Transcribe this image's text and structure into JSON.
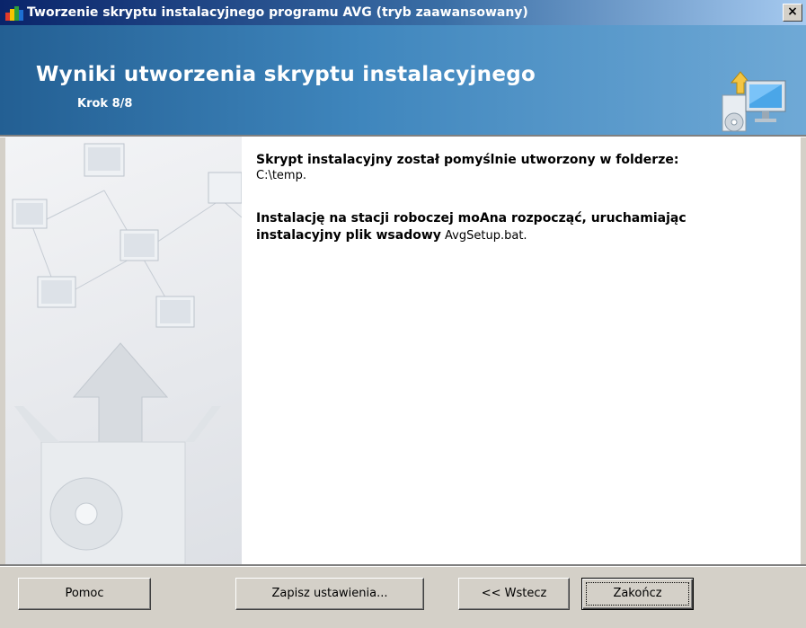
{
  "window": {
    "title": "Tworzenie skryptu instalacyjnego programu AVG (tryb zaawansowany)",
    "close_label": "×"
  },
  "header": {
    "title": "Wyniki utworzenia skryptu instalacyjnego",
    "step": "Krok 8/8"
  },
  "content": {
    "line1": "Skrypt instalacyjny został pomyślnie utworzony w folderze:",
    "folder": "C:\\temp.",
    "line2": "Instalację na stacji roboczej moAna rozpocząć, uruchamiając",
    "line3": "instalacyjny plik wsadowy",
    "batch_file": "AvgSetup.bat."
  },
  "buttons": {
    "help": "Pomoc",
    "save_settings": "Zapisz ustawienia...",
    "back": "<< Wstecz",
    "finish": "Zakończ"
  }
}
